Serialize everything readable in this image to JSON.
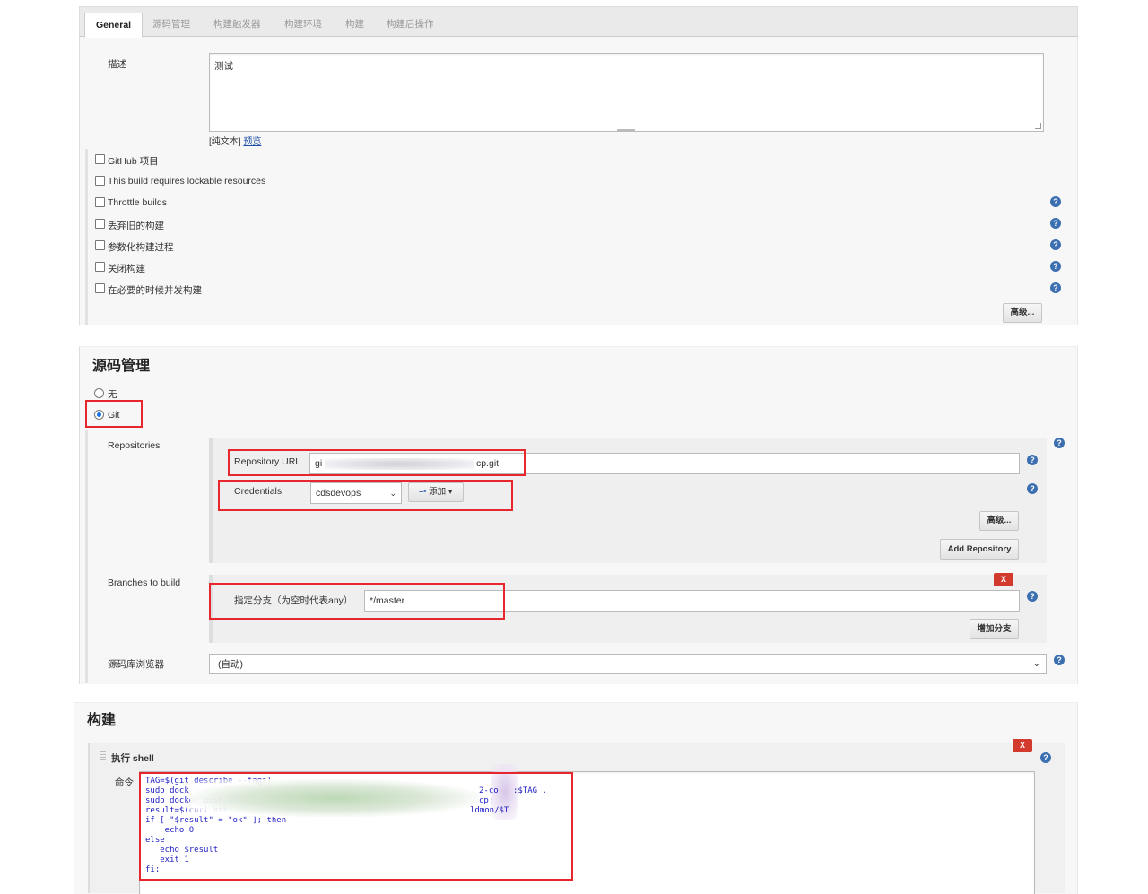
{
  "tabs": [
    "General",
    "源码管理",
    "构建触发器",
    "构建环境",
    "构建",
    "构建后操作"
  ],
  "general": {
    "desc_label": "描述",
    "desc_value": "测试",
    "plain_text": "[纯文本]",
    "preview": "预览",
    "options": [
      "GitHub 项目",
      "This build requires lockable resources",
      "Throttle builds",
      "丢弃旧的构建",
      "参数化构建过程",
      "关闭构建",
      "在必要的时候并发构建"
    ],
    "advanced": "高级..."
  },
  "scm": {
    "title": "源码管理",
    "none_label": "无",
    "git_label": "Git",
    "repositories_label": "Repositories",
    "repo_url_label": "Repository URL",
    "repo_url_value_start": "gi",
    "repo_url_value_end": "cp.git",
    "credentials_label": "Credentials",
    "credentials_value": "cdsdevops",
    "add_label": "添加",
    "advanced": "高级...",
    "add_repository": "Add Repository",
    "branches_label": "Branches to build",
    "branch_spec_label": "指定分支（为空时代表any）",
    "branch_spec_value": "*/master",
    "add_branch": "增加分支",
    "browser_label": "源码库浏览器",
    "browser_value": "(自动)",
    "remove": "X"
  },
  "build": {
    "title": "构建",
    "step_title": "执行 shell",
    "command_label": "命令",
    "remove": "X",
    "command_lines": [
      "TAG=$(git describe --tags)",
      "sudo dock",
      "sudo docker push harbo",
      "result=$(curl htt",
      "if [ \"$result\" = \"ok\" ]; then",
      "    echo 0",
      "else",
      "   echo $result",
      "   exit 1",
      "fi;"
    ],
    "line2_tail": "2-co",
    "line2_tail2": ":$TAG .",
    "line3_tail": "cp:",
    "line4_tail": "ldmon/$T"
  },
  "colors": {
    "highlight_red": "#e8262d",
    "help_blue": "#3c6fb0",
    "code_blue": "#1d1dc2",
    "remove_red": "#d23a2d"
  }
}
